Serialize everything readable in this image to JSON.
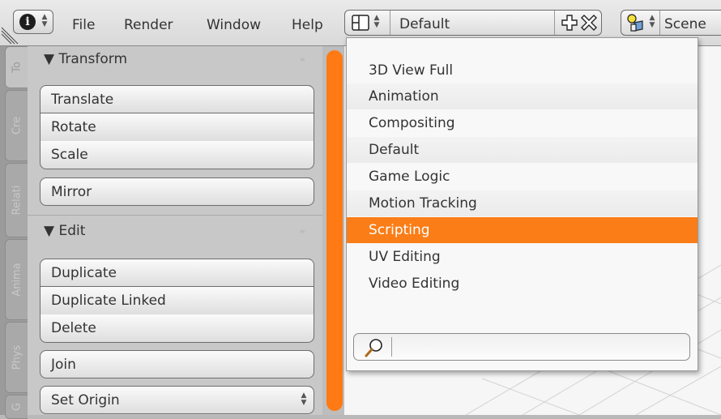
{
  "header": {
    "menus": [
      {
        "label": "File"
      },
      {
        "label": "Render"
      },
      {
        "label": "Window"
      },
      {
        "label": "Help"
      }
    ],
    "screen_layout": "Default",
    "scene": "Scene"
  },
  "side_tabs": [
    "To",
    "Cre",
    "Relati",
    "Anima",
    "Phys",
    "G"
  ],
  "panel": {
    "transform": {
      "title": "Transform",
      "buttons": [
        "Translate",
        "Rotate",
        "Scale",
        "Mirror"
      ]
    },
    "edit": {
      "title": "Edit",
      "buttons": [
        "Duplicate",
        "Duplicate Linked",
        "Delete",
        "Join"
      ],
      "set_origin": "Set Origin"
    }
  },
  "dropdown": {
    "items": [
      "3D View Full",
      "Animation",
      "Compositing",
      "Default",
      "Game Logic",
      "Motion Tracking",
      "Scripting",
      "UV Editing",
      "Video Editing"
    ],
    "selected": "Scripting",
    "search_value": ""
  },
  "colors": {
    "accent": "#fa7d17",
    "scrollbar": "#ff7a14"
  },
  "icons": [
    "info-icon",
    "screen-layout-icon",
    "add-icon",
    "remove-icon",
    "scene-icon",
    "search-icon"
  ]
}
